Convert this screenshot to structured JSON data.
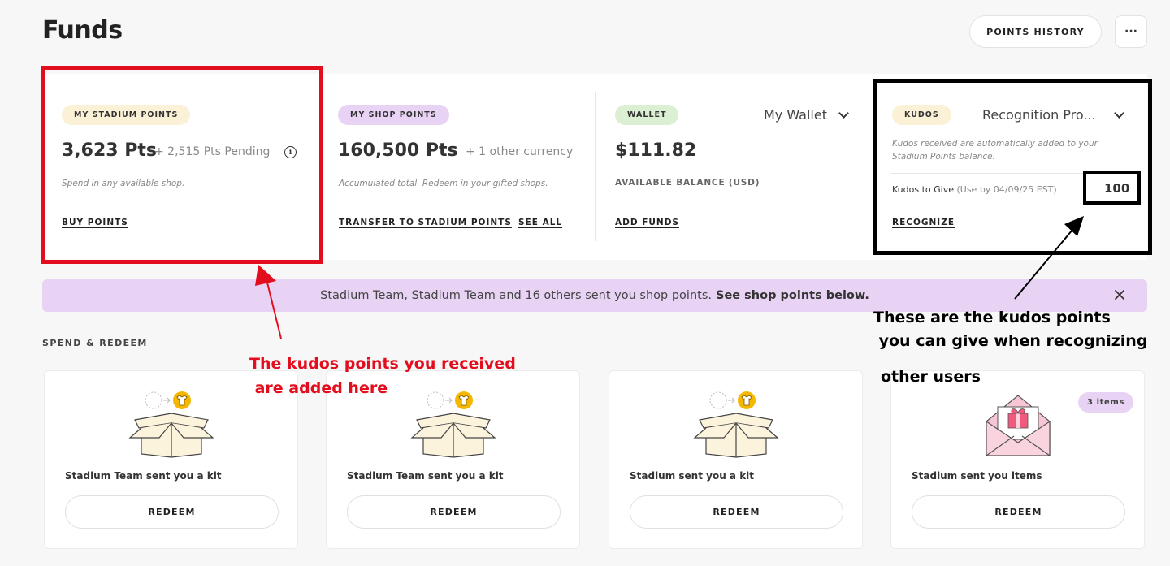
{
  "header": {
    "title": "Funds",
    "history_button": "POINTS HISTORY",
    "more_button": "···"
  },
  "cards": {
    "stadium": {
      "pill": "MY STADIUM POINTS",
      "value": "3,623 Pts",
      "pending": "+ 2,515 Pts Pending",
      "info_icon": "i",
      "note": "Spend in any available shop.",
      "action": "BUY POINTS"
    },
    "shop": {
      "pill": "MY SHOP POINTS",
      "value": "160,500 Pts",
      "other": "+ 1 other currency",
      "note": "Accumulated total. Redeem in your gifted shops.",
      "action_transfer": "TRANSFER TO STADIUM POINTS",
      "action_see_all": "SEE ALL"
    },
    "wallet": {
      "pill": "WALLET",
      "dropdown": "My Wallet",
      "value": "$111.82",
      "label": "AVAILABLE BALANCE (USD)",
      "action": "ADD FUNDS"
    },
    "kudos": {
      "pill": "KUDOS",
      "dropdown": "Recognition Pro...",
      "note_line1": "Kudos received are automatically added to your",
      "note_line2": "Stadium Points balance.",
      "to_give_label": "Kudos to Give",
      "to_give_note": "(Use by 04/09/25 EST)",
      "to_give_value": "100",
      "action": "RECOGNIZE"
    }
  },
  "banner": {
    "text": "Stadium Team, Stadium Team and 16 others sent you shop points.",
    "link": "See shop points below."
  },
  "section": {
    "title": "SPEND & REDEEM"
  },
  "tiles": [
    {
      "text": "Stadium Team sent you a kit",
      "button": "REDEEM"
    },
    {
      "text": "Stadium Team sent you a kit",
      "button": "REDEEM"
    },
    {
      "text": "Stadium sent you a kit",
      "button": "REDEEM"
    },
    {
      "text": "Stadium sent you items",
      "button": "REDEEM",
      "badge": "3 items"
    }
  ],
  "annotations": {
    "red_line1": "The kudos points you received",
    "red_line2": " are added here",
    "black_line1": "These are the kudos points",
    "black_line2": " you can give when recognizing",
    "black_line3": "other users"
  },
  "colors": {
    "annotation_red": "#e30e1d",
    "pill_yellow": "#fbf1d6",
    "pill_purple": "#e8d3f5",
    "pill_green": "#dbf0d3",
    "banner_bg": "#e8d3f5"
  },
  "icons": {
    "kit_art": "open-box-tshirt-icon",
    "items_art": "envelope-gift-icon",
    "close": "close-icon",
    "dropdown": "chevron-down-icon"
  }
}
